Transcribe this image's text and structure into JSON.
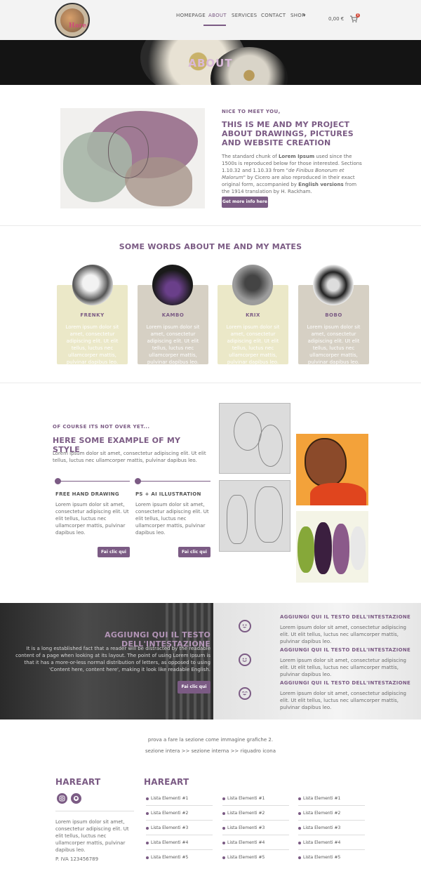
{
  "header": {
    "logo_text": "HareArt",
    "nav": [
      "HOMEPAGE",
      "ABOUT",
      "SERVICES",
      "CONTACT",
      "SHOP"
    ],
    "active_nav": "ABOUT",
    "cart_price": "0,00 €",
    "cart_count": "0"
  },
  "hero": {
    "title": "ABOUT"
  },
  "intro": {
    "kicker": "NICE TO MEET YOU,",
    "heading": "THIS IS ME AND MY PROJECT ABOUT DRAWINGS, PICTURES AND WEBSITE CREATION",
    "body_1": "The standard chunk of ",
    "body_bold_1": "Lorem Ipsum",
    "body_2": " used since the 1500s is reproduced below for those interested. Sections 1.10.32 and 1.10.33 from \"",
    "body_italic": "de Finibus Bonorum et Malorum",
    "body_3": "\" by Cicero are also reproduced in their exact original form, accompanied by ",
    "body_bold_2": "English versions",
    "body_4": " from the 1914 translation by H. Rackham.",
    "button": "Get more info here"
  },
  "team": {
    "title": "SOME WORDS ABOUT ME AND MY MATES",
    "members": [
      {
        "name": "FRENKY",
        "text": "Lorem ipsum dolor sit amet, consectetur adipiscing elit. Ut elit tellus, luctus nec ullamcorper mattis, pulvinar dapibus leo.",
        "color": "#ebe8c8"
      },
      {
        "name": "KAMBO",
        "text": "Lorem ipsum dolor sit amet, consectetur adipiscing elit. Ut elit tellus, luctus nec ullamcorper mattis, pulvinar dapibus leo.",
        "color": "#d6d0c4"
      },
      {
        "name": "KRIX",
        "text": "Lorem ipsum dolor sit amet, consectetur adipiscing elit. Ut elit tellus, luctus nec ullamcorper mattis, pulvinar dapibus leo.",
        "color": "#ebe8c8"
      },
      {
        "name": "BOBO",
        "text": "Lorem ipsum dolor sit amet, consectetur adipiscing elit. Ut elit tellus, luctus nec ullamcorper mattis, pulvinar dapibus leo.",
        "color": "#d6d0c4"
      }
    ]
  },
  "style": {
    "kicker": "OF COURSE ITS NOT OVER YET...",
    "heading": "HERE SOME EXAMPLE OF MY STYLE",
    "body": "Lorem ipsum dolor sit amet, consectetur adipiscing elit. Ut elit tellus, luctus nec ullamcorper mattis, pulvinar dapibus leo.",
    "items": [
      {
        "title": "FREE HAND DRAWING",
        "text": "Lorem ipsum dolor sit amet, consectetur adipiscing elit. Ut elit tellus, luctus nec ullamcorper mattis, pulvinar dapibus leo.",
        "button": "Fai clic qui"
      },
      {
        "title": "PS + AI ILLUSTRATION",
        "text": "Lorem ipsum dolor sit amet, consectetur adipiscing elit. Ut elit tellus, luctus nec ullamcorper mattis, pulvinar dapibus leo.",
        "button": "Fai clic qui"
      }
    ]
  },
  "band": {
    "heading": "AGGIUNGI QUI IL TESTO DELL'INTESTAZIONE",
    "body": "It is a long established fact that a reader will be distracted by the readable content of a page when looking at its layout. The point of using Lorem Ipsum is that it has a more-or-less normal distribution of letters, as opposed to using 'Content here, content here', making it look like readable English.",
    "button": "Fai clic qui",
    "features": [
      {
        "title": "AGGIUNGI QUI IL TESTO DELL'INTESTAZIONE",
        "text": "Lorem ipsum dolor sit amet, consectetur adipiscing elit. Ut elit tellus, luctus nec ullamcorper mattis, pulvinar dapibus leo."
      },
      {
        "title": "AGGIUNGI QUI IL TESTO DELL'INTESTAZIONE",
        "text": "Lorem ipsum dolor sit amet, consectetur adipiscing elit. Ut elit tellus, luctus nec ullamcorper mattis, pulvinar dapibus leo."
      },
      {
        "title": "AGGIUNGI QUI IL TESTO DELL'INTESTAZIONE",
        "text": "Lorem ipsum dolor sit amet, consectetur adipiscing elit. Ut elit tellus, luctus nec ullamcorper mattis, pulvinar dapibus leo."
      }
    ]
  },
  "notes": {
    "line_1": "prova a fare la sezione come immagine grafiche 2.",
    "line_2": "sezione intera >> sezione interna >> riquadro icona"
  },
  "footer": {
    "brand": "HAREART",
    "text": "Lorem ipsum dolor sit amet, consectetur adipiscing elit. Ut elit tellus, luctus nec ullamcorper mattis, pulvinar dapibus leo.",
    "vat": "P. IVA 123456789",
    "links_title": "HAREART",
    "col_1": [
      "Lista Elementi #1",
      "Lista Elementi #2",
      "Lista Elementi #3",
      "Lista Elementi #4",
      "Lista Elementi #5"
    ],
    "col_2": [
      "Lista Elementi #1",
      "Lista Elementi #2",
      "Lista Elementi #3",
      "Lista Elementi #4",
      "Lista Elementi #5"
    ],
    "col_3": [
      "Lista Elementi #1",
      "Lista Elementi #2",
      "Lista Elementi #3",
      "Lista Elementi #4",
      "Lista Elementi #5"
    ]
  },
  "colors": {
    "accent": "#7b5b84",
    "header_bg": "#f3f3f3",
    "card_yellow": "#ebe8c8",
    "card_grey": "#d6d0c4"
  },
  "icons": [
    "cart-icon",
    "smiley-icon",
    "instagram-icon",
    "github-icon",
    "chevron-down-icon"
  ]
}
